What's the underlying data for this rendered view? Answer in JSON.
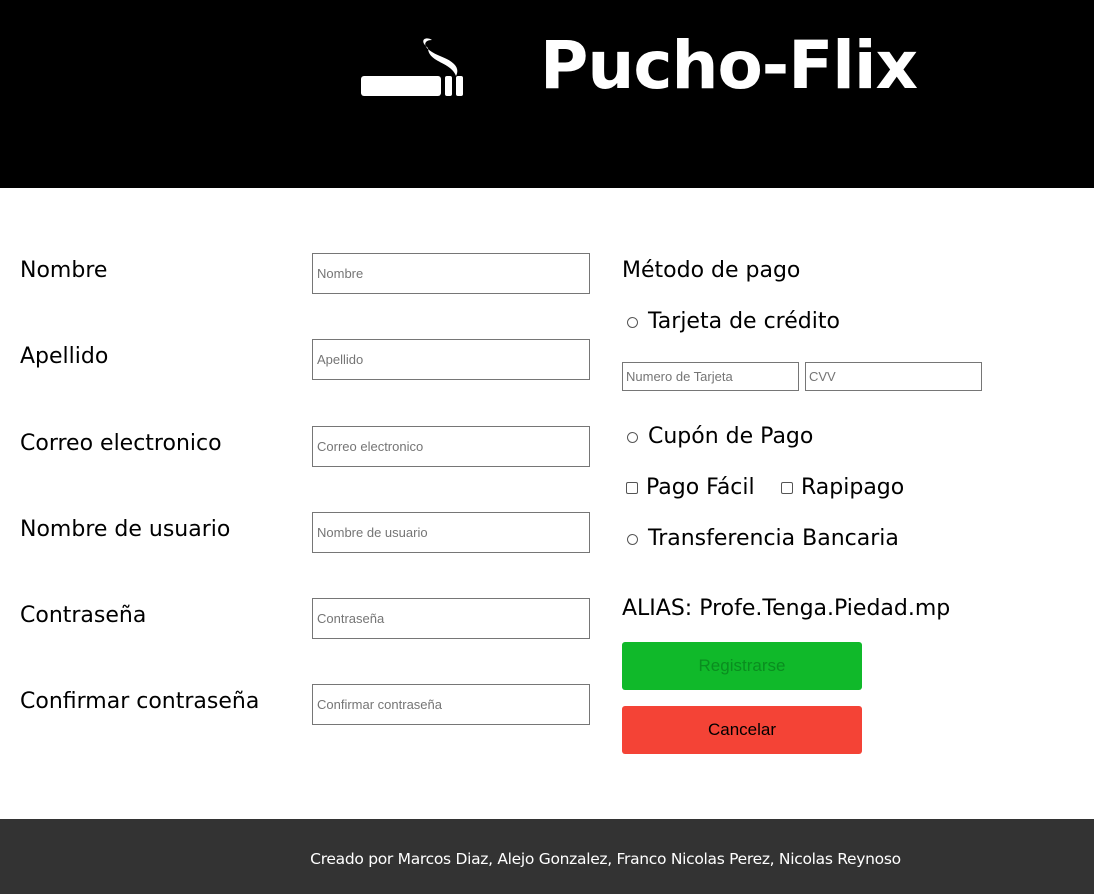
{
  "header": {
    "brand": "Pucho-Flix",
    "logo_icon": "cigarette-icon",
    "background": "#000000"
  },
  "form": {
    "fields": [
      {
        "label": "Nombre",
        "placeholder": "Nombre",
        "value": ""
      },
      {
        "label": "Apellido",
        "placeholder": "Apellido",
        "value": ""
      },
      {
        "label": "Correo electronico",
        "placeholder": "Correo electronico",
        "value": ""
      },
      {
        "label": "Nombre de usuario",
        "placeholder": "Nombre de usuario",
        "value": ""
      },
      {
        "label": "Contraseña",
        "placeholder": "Contraseña",
        "value": ""
      },
      {
        "label": "Confirmar contraseña",
        "placeholder": "Confirmar contraseña",
        "value": ""
      }
    ]
  },
  "payment": {
    "title": "Método de pago",
    "credit_card": {
      "label": "Tarjeta de crédito",
      "card_number_placeholder": "Numero de Tarjeta",
      "cvv_placeholder": "CVV"
    },
    "coupon": {
      "label": "Cupón de Pago",
      "options": [
        "Pago Fácil",
        "Rapipago"
      ]
    },
    "transfer": {
      "label": "Transferencia Bancaria"
    },
    "alias": "ALIAS: Profe.Tenga.Piedad.mp"
  },
  "buttons": {
    "register": "Registrarse",
    "cancel": "Cancelar",
    "register_color": "#10b92a",
    "cancel_color": "#f44336"
  },
  "footer": {
    "credits": "Creado por Marcos Diaz, Alejo Gonzalez, Franco Nicolas Perez, Nicolas Reynoso",
    "background": "#333333"
  }
}
